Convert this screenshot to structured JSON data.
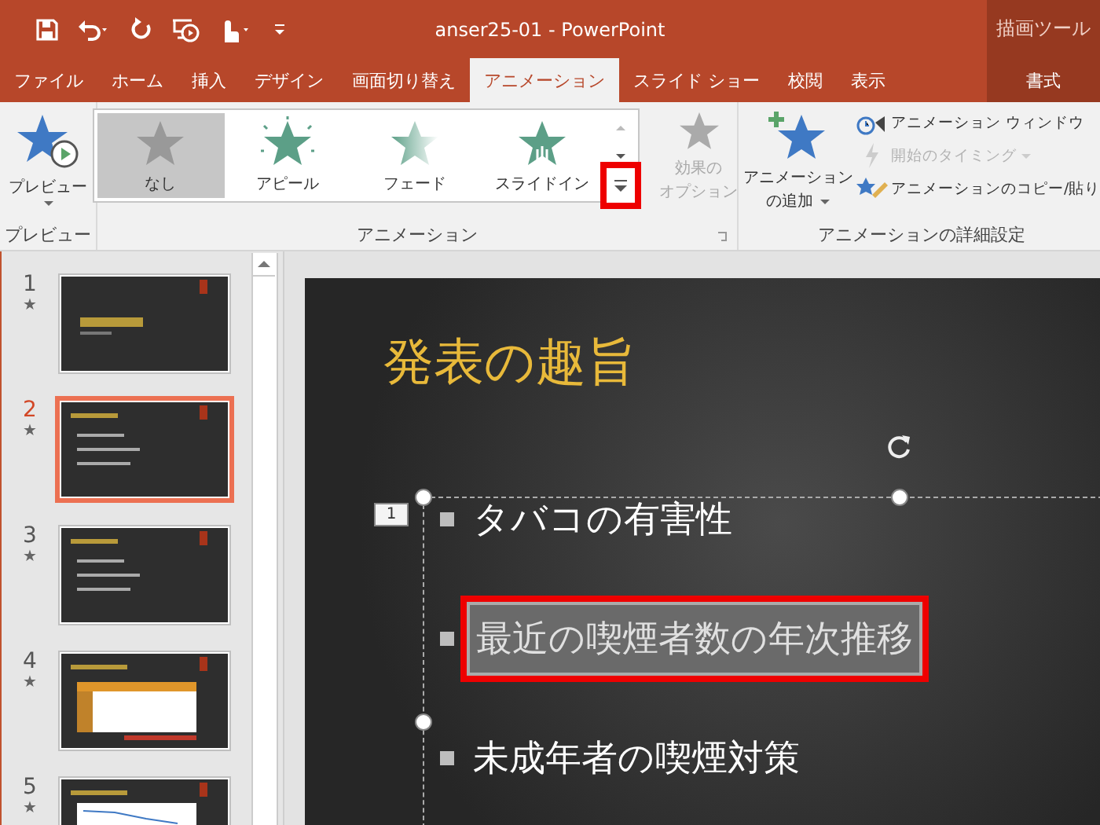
{
  "window": {
    "title": "anser25-01  -  PowerPoint",
    "context_group": "描画ツール"
  },
  "tabs": [
    {
      "label": "ファイル",
      "selected": false,
      "kind": "normal"
    },
    {
      "label": "ホーム",
      "selected": false,
      "kind": "normal"
    },
    {
      "label": "挿入",
      "selected": false,
      "kind": "normal"
    },
    {
      "label": "デザイン",
      "selected": false,
      "kind": "normal"
    },
    {
      "label": "画面切り替え",
      "selected": false,
      "kind": "normal"
    },
    {
      "label": "アニメーション",
      "selected": true,
      "kind": "normal"
    },
    {
      "label": "スライド ショー",
      "selected": false,
      "kind": "normal"
    },
    {
      "label": "校閲",
      "selected": false,
      "kind": "normal"
    },
    {
      "label": "表示",
      "selected": false,
      "kind": "normal"
    },
    {
      "label": "書式",
      "selected": false,
      "kind": "contextual"
    }
  ],
  "ribbon": {
    "preview": {
      "button": "プレビュー",
      "group_label": "プレビュー"
    },
    "gallery": {
      "items": [
        {
          "label": "なし",
          "selected": true,
          "kind": "none"
        },
        {
          "label": "アピール",
          "selected": false,
          "kind": "appear"
        },
        {
          "label": "フェード",
          "selected": false,
          "kind": "fade"
        },
        {
          "label": "スライドイン",
          "selected": false,
          "kind": "flyin"
        }
      ],
      "more_highlighted": true,
      "group_label": "アニメーション"
    },
    "effect_options": {
      "lines": [
        "効果の",
        "オプション"
      ],
      "disabled": true
    },
    "advanced": {
      "add_lines": [
        "アニメーション",
        "の追加"
      ],
      "items": [
        {
          "label": "アニメーション ウィンドウ",
          "disabled": false,
          "kind": "pane"
        },
        {
          "label": "開始のタイミング",
          "disabled": true,
          "kind": "trigger"
        },
        {
          "label": "アニメーションのコピー/貼り",
          "disabled": false,
          "kind": "painter"
        }
      ],
      "group_label": "アニメーションの詳細設定"
    }
  },
  "slides": [
    {
      "number": "1",
      "mark": "★",
      "selected": false,
      "kind": "title"
    },
    {
      "number": "2",
      "mark": "★",
      "selected": true,
      "kind": "bullets"
    },
    {
      "number": "3",
      "mark": "★",
      "selected": false,
      "kind": "bullets"
    },
    {
      "number": "4",
      "mark": "★",
      "selected": false,
      "kind": "table"
    },
    {
      "number": "5",
      "mark": "★",
      "selected": false,
      "kind": "chart"
    }
  ],
  "slide": {
    "title": "発表の趣旨",
    "animation_tag": "1",
    "bullets": [
      {
        "text": "タバコの有害性",
        "selected": false
      },
      {
        "text": "最近の喫煙者数の年次推移",
        "selected": true
      },
      {
        "text": "未成年者の喫煙対策",
        "selected": false
      }
    ]
  }
}
